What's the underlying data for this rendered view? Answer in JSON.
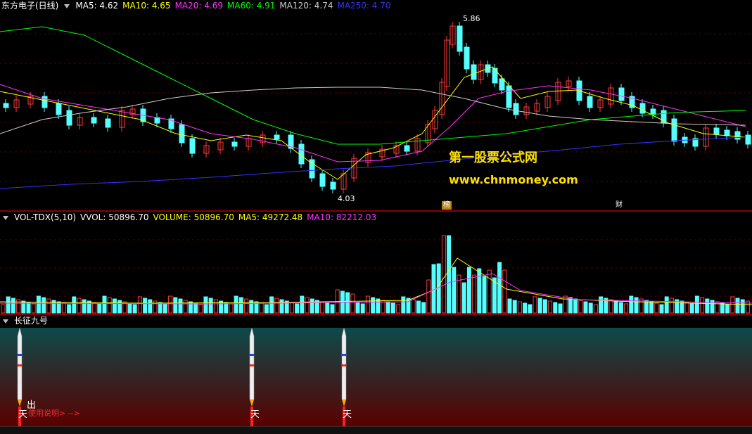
{
  "price_pane": {
    "stock_name": "东方电子(日线)",
    "indicators": [
      {
        "label": "MA5: 4.62",
        "color": "#ffffff"
      },
      {
        "label": "MA10: 4.65",
        "color": "#ffff00"
      },
      {
        "label": "MA20: 4.69",
        "color": "#ff33ff"
      },
      {
        "label": "MA60: 4.91",
        "color": "#00ff00"
      },
      {
        "label": "MA120: 4.74",
        "color": "#cccccc"
      },
      {
        "label": "MA250: 4.70",
        "color": "#3333ff"
      }
    ],
    "high_label": "5.86",
    "low_label": "4.03",
    "tag_bang": "榜",
    "tag_cai": "财",
    "watermark_title": "第一股票公式网",
    "watermark_url": "www.chnmoney.com"
  },
  "volume_pane": {
    "indicator_name": "VOL-TDX(5,10)",
    "indicators": [
      {
        "label": "VVOL: 50896.70",
        "color": "#ffffff"
      },
      {
        "label": "VOLUME: 50896.70",
        "color": "#ffff00"
      },
      {
        "label": "MA5: 49272.48",
        "color": "#ffff00"
      },
      {
        "label": "MA10: 82212.03",
        "color": "#ff33ff"
      }
    ]
  },
  "signal_pane": {
    "indicator_name": "长征九号",
    "chu_label": "出",
    "tian_label": "天",
    "usage_label": "使用说明> -->"
  },
  "colors": {
    "up": "#ff3c3c",
    "down": "#54ffff",
    "grid": "#5a0000"
  }
}
